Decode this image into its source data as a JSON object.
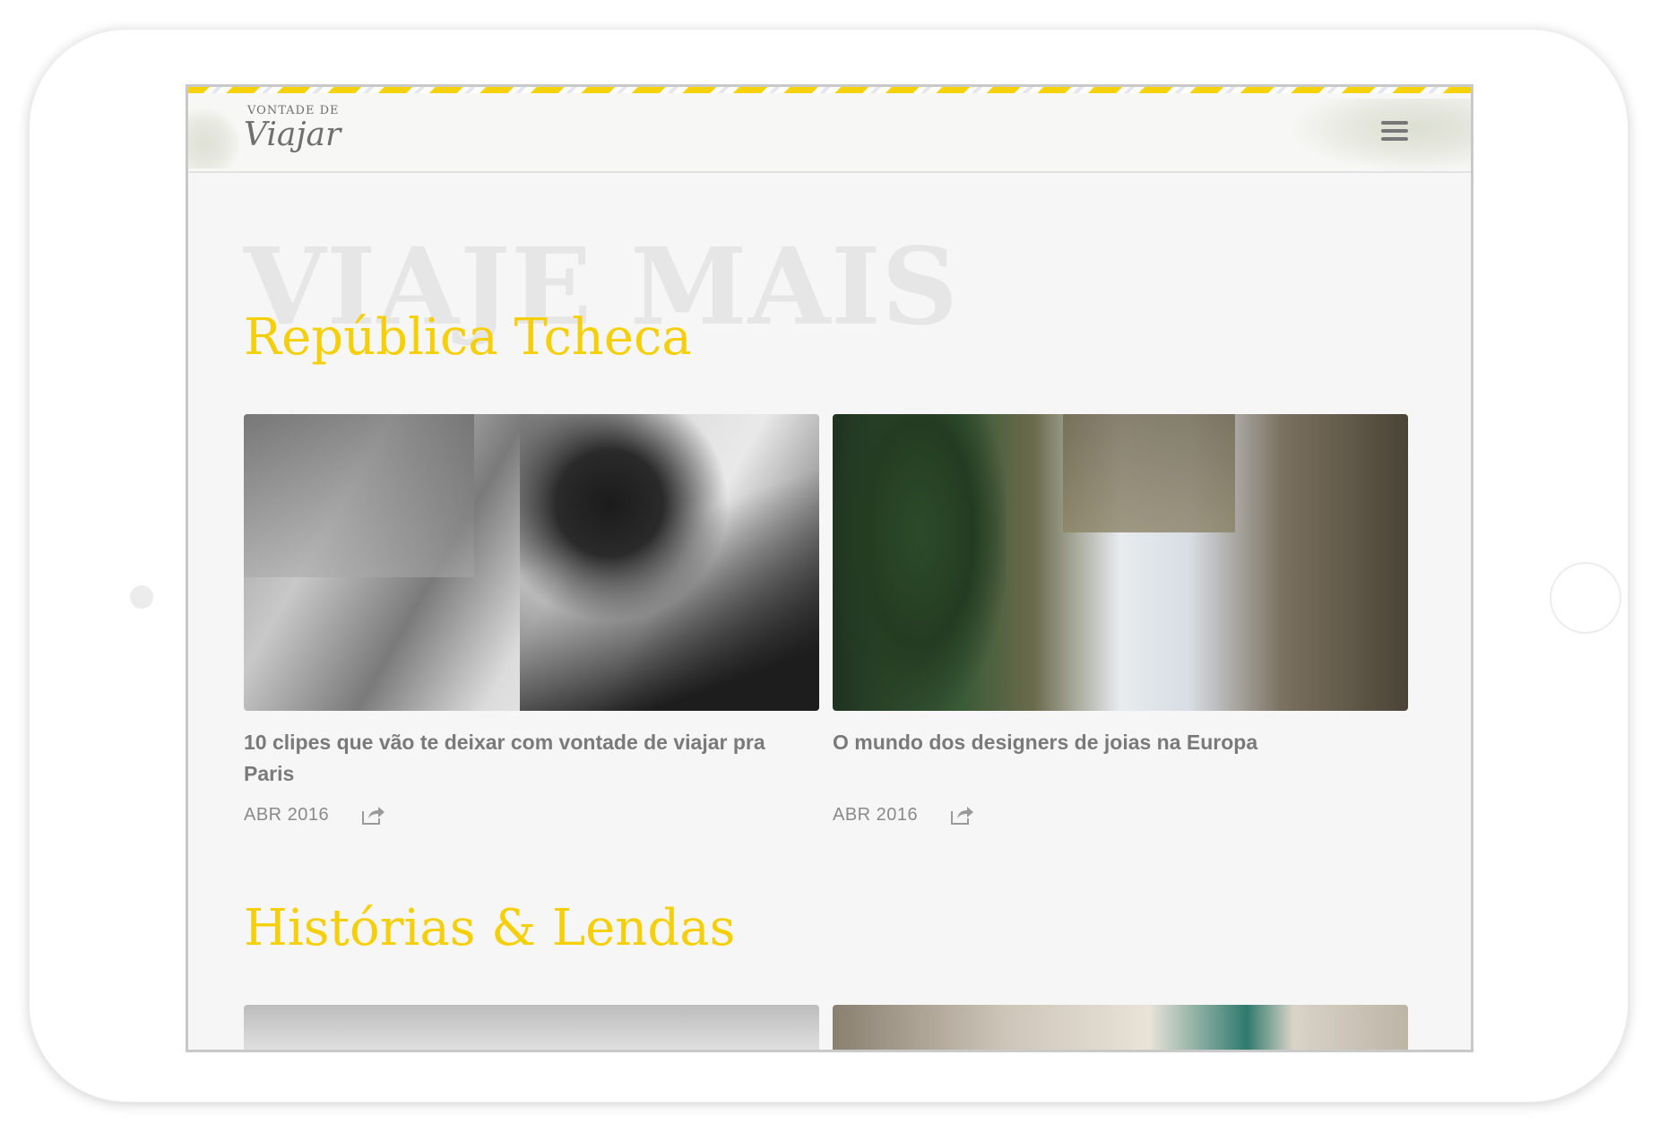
{
  "header": {
    "logo_top": "VONTADE DE",
    "logo_main": "Viajar"
  },
  "hero": {
    "background_title": "VIAJE MAIS"
  },
  "sections": [
    {
      "title": "República Tcheca",
      "cards": [
        {
          "title": "10 clipes que vão te deixar com vontade de viajar pra Paris",
          "date": "ABR 2016",
          "image": "black-and-white-woman-sunglasses-car-photo"
        },
        {
          "title": "O mundo dos designers de joias na Europa",
          "date": "ABR 2016",
          "image": "woman-hands-with-rings-white-dress-photo"
        }
      ]
    },
    {
      "title": "Histórias & Lendas",
      "cards": [
        {
          "image": "cloudy-sky-photo"
        },
        {
          "image": "building-facade-statue-photo"
        }
      ]
    }
  ],
  "icons": {
    "menu": "hamburger-menu-icon",
    "share": "share-icon"
  },
  "colors": {
    "accent": "#f5d00a",
    "text": "#7a7a7a",
    "background": "#f6f6f6"
  }
}
